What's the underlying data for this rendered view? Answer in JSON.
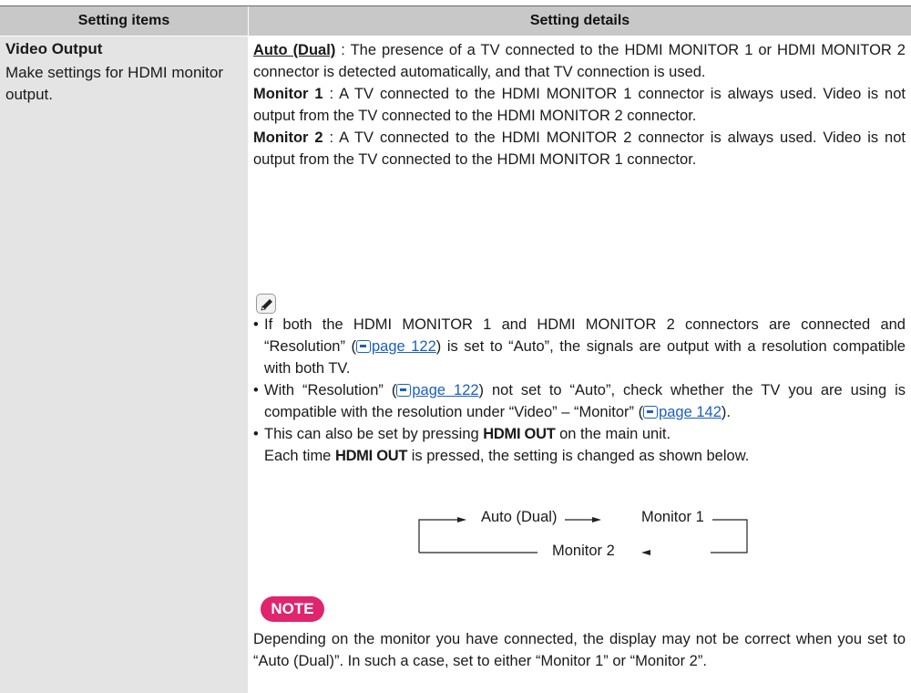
{
  "header": {
    "col1": "Setting items",
    "col2": "Setting details"
  },
  "item": {
    "title": "Video Output",
    "description": "Make settings for HDMI monitor output."
  },
  "options": [
    {
      "name": "Auto (Dual)",
      "text": " : The presence of a TV connected to the HDMI MONITOR 1 or HDMI MONITOR 2 connector is detected automatically, and that TV connection is used."
    },
    {
      "name": "Monitor 1",
      "text": " : A TV connected to the HDMI MONITOR 1 connector is always used. Video is not output from the TV connected to the HDMI MONITOR 2 connector."
    },
    {
      "name": "Monitor 2",
      "text": " : A TV connected to the HDMI MONITOR 2 connector is always used. Video is not output from the TV connected to the HDMI MONITOR 1 connector."
    }
  ],
  "icons": {
    "pencil": "pencil-icon",
    "ref": "page-reference-icon"
  },
  "notes": {
    "b1_pre": "If both the HDMI MONITOR 1 and HDMI MONITOR 2 connectors are connected and “Resolution” (",
    "b1_link": "page 122",
    "b1_post": ") is set to “Auto”, the signals are output with a resolution compatible with both TV.",
    "b2_pre": "With “Resolution” (",
    "b2_link1": "page 122",
    "b2_mid": ") not set to “Auto”, check whether the TV you are using is compatible with the resolution under “Video” – “Monitor” (",
    "b2_link2": "page 142",
    "b2_post": ").",
    "b3_pre": "This can also be set by pressing ",
    "b3_key": "HDMI OUT",
    "b3_post": " on the main unit.",
    "b3_line2_pre": "Each time ",
    "b3_line2_key": "HDMI OUT",
    "b3_line2_post": " is pressed, the setting is changed as shown below."
  },
  "flow": {
    "step1": "Auto (Dual)",
    "step2": "Monitor 1",
    "step3": "Monitor 2"
  },
  "note": {
    "badge": "NOTE",
    "text": "Depending on the monitor you have connected, the display may not be correct when you set to “Auto (Dual)”. In such a case, set to either “Monitor 1” or “Monitor 2”."
  },
  "colors": {
    "header_bg": "#c8c8c8",
    "item_col_bg": "#e4e4e4",
    "note_badge": "#e0246e",
    "link": "#1c5fbf"
  }
}
